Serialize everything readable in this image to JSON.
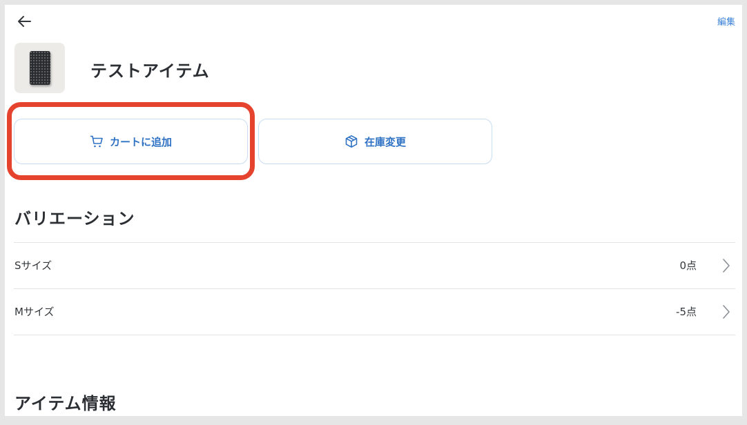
{
  "header": {
    "edit_label": "編集"
  },
  "item": {
    "title": "テストアイテム"
  },
  "actions": {
    "add_to_cart_label": "カートに追加",
    "stock_change_label": "在庫変更"
  },
  "variations": {
    "heading": "バリエーション",
    "rows": [
      {
        "name": "Sサイズ",
        "count": "0点"
      },
      {
        "name": "Mサイズ",
        "count": "-5点"
      }
    ]
  },
  "info": {
    "heading": "アイテム情報"
  },
  "icons": {
    "back": "arrow-left-icon",
    "cart": "cart-icon",
    "box": "box-icon",
    "chevron": "chevron-right-icon"
  },
  "colors": {
    "accent": "#2f72c4",
    "button_border": "#c8dcf2",
    "highlight": "#e5432e",
    "text": "#2b2f33"
  }
}
